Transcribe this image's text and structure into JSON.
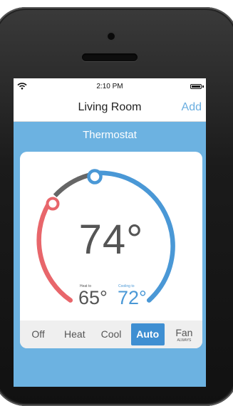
{
  "status_bar": {
    "time": "2:10 PM"
  },
  "nav": {
    "title": "Living Room",
    "add_label": "Add"
  },
  "section": {
    "title": "Thermostat"
  },
  "thermostat": {
    "current_temp": "74°",
    "heat_label": "Heat to",
    "heat_value": "65°",
    "cool_label": "Cooling to",
    "cool_value": "72°"
  },
  "modes": [
    {
      "label": "Off",
      "sub": ""
    },
    {
      "label": "Heat",
      "sub": ""
    },
    {
      "label": "Cool",
      "sub": ""
    },
    {
      "label": "Auto",
      "sub": ""
    },
    {
      "label": "Fan",
      "sub": "ALWAYS"
    }
  ],
  "selected_mode": "Auto",
  "colors": {
    "accent": "#3f8fd2",
    "heat": "#e8666b",
    "cool": "#4a98d6",
    "background": "#6cb2e1"
  }
}
